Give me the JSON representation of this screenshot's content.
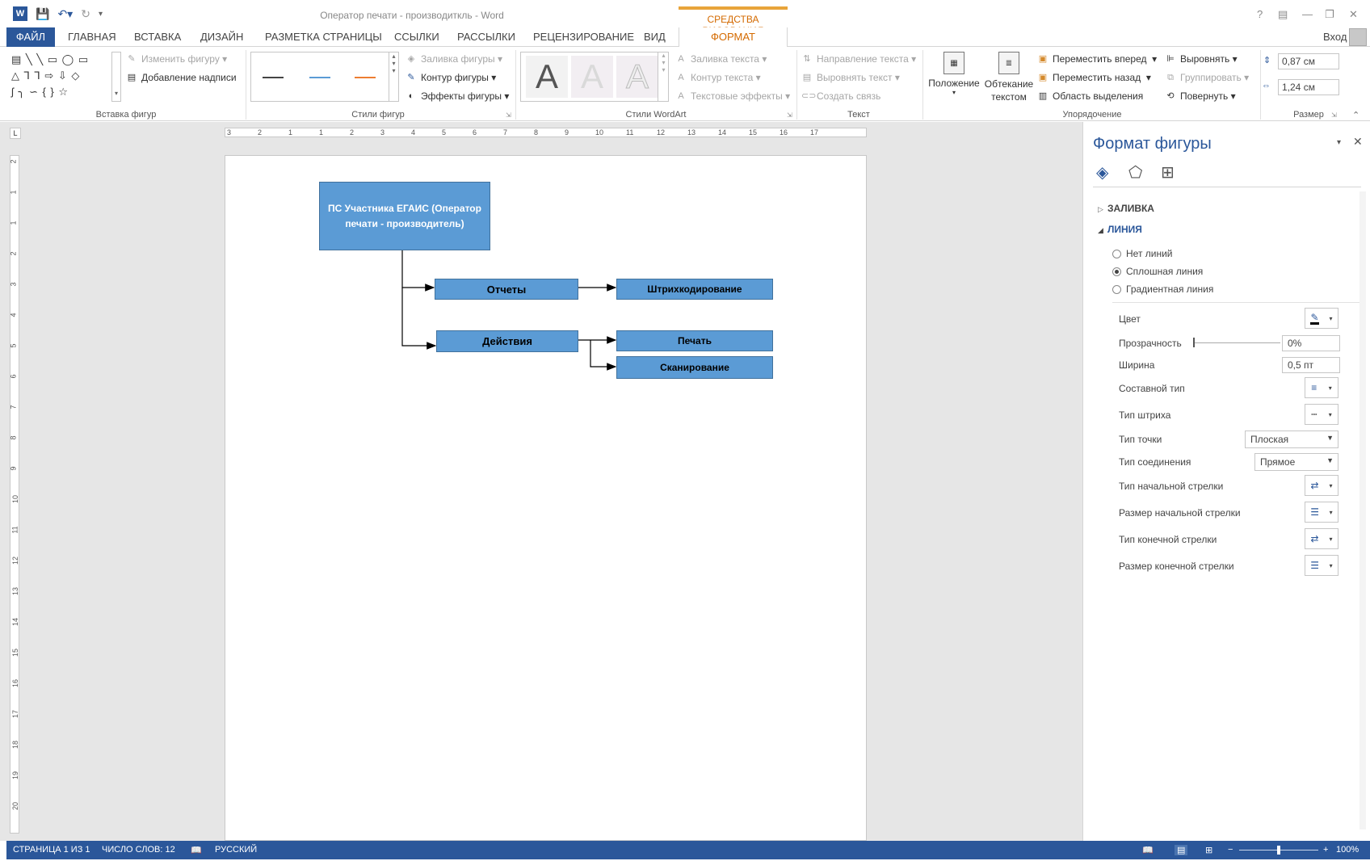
{
  "titlebar": {
    "doc_title": "Оператор печати - производиткль - Word",
    "tools_context": "СРЕДСТВА РИСОВАНИЯ",
    "help": "?",
    "login": "Вход"
  },
  "tabs": {
    "file": "ФАЙЛ",
    "items": [
      "ГЛАВНАЯ",
      "ВСТАВКА",
      "ДИЗАЙН",
      "РАЗМЕТКА СТРАНИЦЫ",
      "ССЫЛКИ",
      "РАССЫЛКИ",
      "РЕЦЕНЗИРОВАНИЕ",
      "ВИД"
    ],
    "active": "ФОРМАТ"
  },
  "ribbon": {
    "insert_shapes": {
      "label": "Вставка фигур",
      "edit_shape": "Изменить фигуру",
      "add_text": "Добавление надписи"
    },
    "shape_styles": {
      "label": "Стили фигур",
      "fill": "Заливка фигуры",
      "outline": "Контур фигуры",
      "effects": "Эффекты фигуры",
      "line_colors": [
        "#444444",
        "#5b9bd5",
        "#ed7d31"
      ]
    },
    "wordart": {
      "label": "Стили WordArt",
      "letter": "A",
      "text_fill": "Заливка текста",
      "text_outline": "Контур текста",
      "text_effects": "Текстовые эффекты"
    },
    "text": {
      "label": "Текст",
      "direction": "Направление текста",
      "align": "Выровнять текст",
      "link": "Создать связь"
    },
    "arrange": {
      "label": "Упорядочение",
      "position": "Положение",
      "wrap": "Обтекание текстом",
      "forward": "Переместить вперед",
      "backward": "Переместить назад",
      "selection": "Область выделения",
      "align": "Выровнять",
      "group": "Группировать",
      "rotate": "Повернуть"
    },
    "size": {
      "label": "Размер",
      "height": "0,87 см",
      "width": "1,24 см"
    }
  },
  "ruler": {
    "h_ticks": [
      "3",
      "2",
      "1",
      "1",
      "2",
      "3",
      "4",
      "5",
      "6",
      "7",
      "8",
      "9",
      "10",
      "11",
      "12",
      "13",
      "14",
      "15",
      "16",
      "17"
    ],
    "v_ticks": [
      "2",
      "1",
      "1",
      "2",
      "3",
      "4",
      "5",
      "6",
      "7",
      "8",
      "9",
      "10",
      "11",
      "12",
      "13",
      "14",
      "15",
      "16",
      "17",
      "18",
      "19",
      "20"
    ]
  },
  "diagram": {
    "main": "ПС Участника ЕГАИС (Оператор печати - производитель)",
    "reports": "Отчеты",
    "barcoding": "Штрихкодирование",
    "actions": "Действия",
    "print": "Печать",
    "scan": "Сканирование"
  },
  "pane": {
    "title": "Формат фигуры",
    "fill_section": "ЗАЛИВКА",
    "line_section": "ЛИНИЯ",
    "radio_none": "Нет линий",
    "radio_solid": "Сплошная линия",
    "radio_gradient": "Градиентная линия",
    "color": "Цвет",
    "transparency": "Прозрачность",
    "transparency_value": "0%",
    "width": "Ширина",
    "width_value": "0,5 пт",
    "compound": "Составной тип",
    "dash": "Тип штриха",
    "cap": "Тип точки",
    "cap_value": "Плоская",
    "join": "Тип соединения",
    "join_value": "Прямое",
    "begin_arrow_type": "Тип начальной стрелки",
    "begin_arrow_size": "Размер начальной стрелки",
    "end_arrow_type": "Тип конечной стрелки",
    "end_arrow_size": "Размер конечной стрелки"
  },
  "status": {
    "page": "СТРАНИЦА 1 ИЗ 1",
    "words": "ЧИСЛО СЛОВ: 12",
    "language": "РУССКИЙ",
    "zoom": "100%",
    "zoom_level": 1.0
  },
  "colors": {
    "accent": "#2b579a",
    "format_tab": "#d46a00",
    "shape_fill": "#5b9bd5",
    "shape_border": "#41719c"
  }
}
